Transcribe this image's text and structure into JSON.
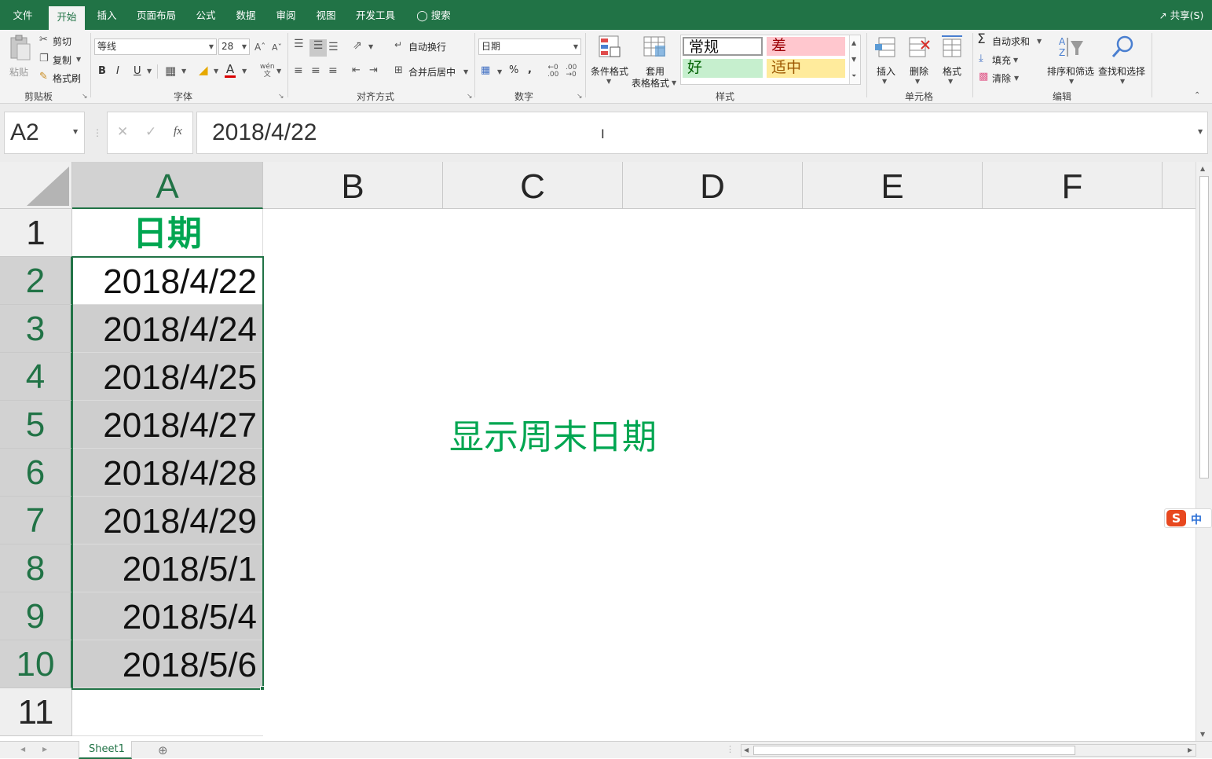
{
  "tabs": [
    {
      "label": "文件",
      "active": false
    },
    {
      "label": "开始",
      "active": true
    },
    {
      "label": "插入",
      "active": false
    },
    {
      "label": "页面布局",
      "active": false
    },
    {
      "label": "公式",
      "active": false
    },
    {
      "label": "数据",
      "active": false
    },
    {
      "label": "审阅",
      "active": false
    },
    {
      "label": "视图",
      "active": false
    },
    {
      "label": "开发工具",
      "active": false
    }
  ],
  "search_label": "搜索",
  "share_label": "共享(S)",
  "clipboard": {
    "paste": "粘贴",
    "cut": "剪切",
    "copy": "复制",
    "format_painter": "格式刷",
    "group": "剪贴板"
  },
  "font": {
    "name": "等线",
    "size": "28",
    "bold": "B",
    "italic": "I",
    "underline": "U",
    "group": "字体",
    "wen": "wén"
  },
  "alignment": {
    "wrap": "自动换行",
    "merge": "合并后居中",
    "group": "对齐方式"
  },
  "number": {
    "format": "日期",
    "group": "数字",
    "percent": "%",
    "comma": ","
  },
  "styles": {
    "conditional": "条件格式",
    "table_line1": "套用",
    "table_line2": "表格格式",
    "normal": "常规",
    "bad": "差",
    "good": "好",
    "neutral": "适中",
    "group": "样式"
  },
  "cells_group": {
    "insert": "插入",
    "delete": "删除",
    "format": "格式",
    "group": "单元格"
  },
  "editing": {
    "autosum": "自动求和",
    "fill": "填充",
    "clear": "清除",
    "sort": "排序和筛选",
    "find": "查找和选择",
    "group": "编辑"
  },
  "formula_bar": {
    "name_box": "A2",
    "value": "2018/4/22",
    "fx": "fx"
  },
  "columns": [
    "A",
    "B",
    "C",
    "D",
    "E",
    "F"
  ],
  "rows": [
    "1",
    "2",
    "3",
    "4",
    "5",
    "6",
    "7",
    "8",
    "9",
    "10",
    "11"
  ],
  "column_a": [
    "日期",
    "2018/4/22",
    "2018/4/24",
    "2018/4/25",
    "2018/4/27",
    "2018/4/28",
    "2018/4/29",
    "2018/5/1",
    "2018/5/4",
    "2018/5/6"
  ],
  "annotation": "显示周末日期",
  "sheet_tab": "Sheet1",
  "ime": "中",
  "colors": {
    "accent": "#217346",
    "header_green": "#00a651",
    "annotation_green": "#00a651",
    "bad_bg": "#ffc7ce",
    "bad_fg": "#9c0006",
    "good_bg": "#c6efce",
    "good_fg": "#006100",
    "neutral_bg": "#ffeb9c",
    "neutral_fg": "#9c5700",
    "highlight": "#cecece"
  }
}
